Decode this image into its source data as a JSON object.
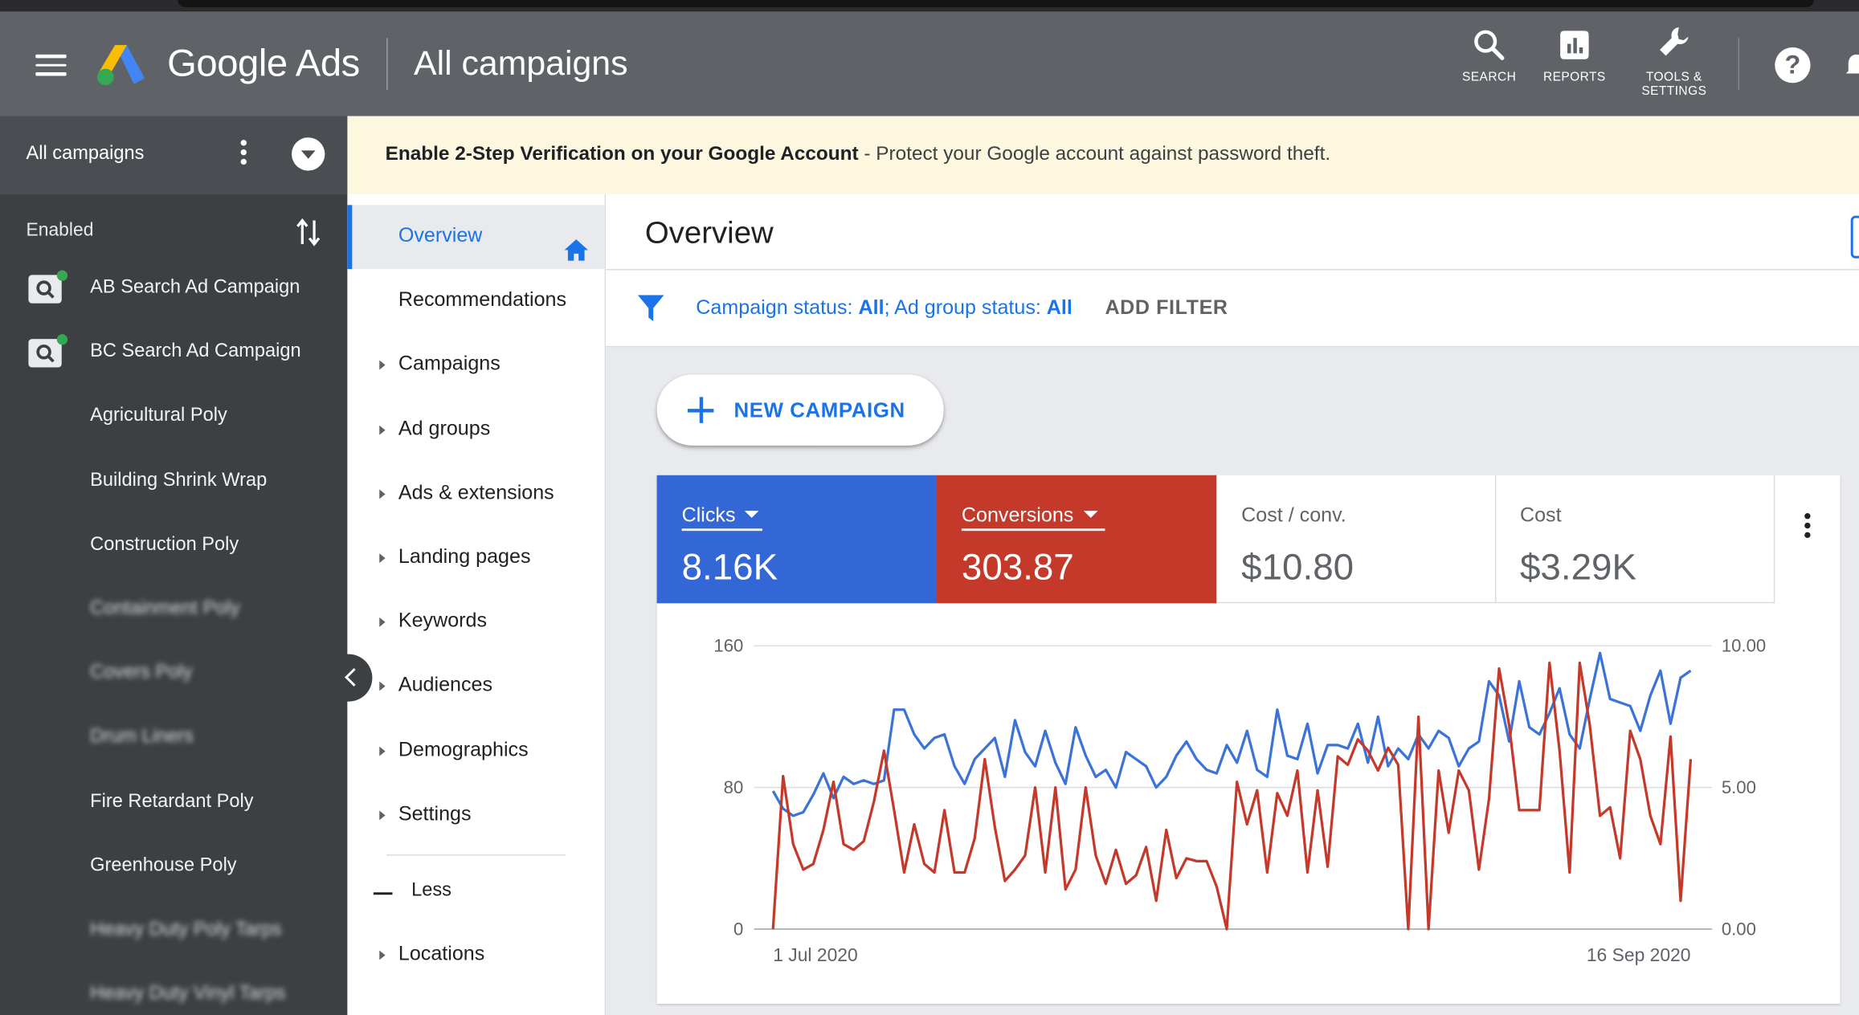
{
  "app": {
    "brand": "Google Ads",
    "page_title": "All campaigns"
  },
  "header": {
    "buttons": [
      {
        "label": "SEARCH",
        "icon": "search-icon"
      },
      {
        "label": "REPORTS",
        "icon": "reports-icon"
      },
      {
        "label_line1": "TOOLS &",
        "label_line2": "SETTINGS",
        "icon": "wrench-icon"
      }
    ],
    "help": "?"
  },
  "sidebar": {
    "title": "All campaigns",
    "section": "Enabled",
    "campaigns": [
      {
        "label": "AB Search Ad Campaign",
        "type": "search",
        "status_color": "#34a853"
      },
      {
        "label": "BC Search Ad Campaign",
        "type": "search",
        "status_color": "#34a853"
      },
      {
        "label": "Agricultural Poly"
      },
      {
        "label": "Building Shrink Wrap"
      },
      {
        "label": "Construction Poly"
      },
      {
        "label": "Containment Poly",
        "redacted": true
      },
      {
        "label": "Covers Poly",
        "redacted": true
      },
      {
        "label": "Drum Liners",
        "redacted": true
      },
      {
        "label": "Fire Retardant Poly"
      },
      {
        "label": "Greenhouse Poly"
      },
      {
        "label": "Heavy Duty Poly Tarps",
        "redacted": true
      },
      {
        "label": "Heavy Duty Vinyl Tarps",
        "redacted": true
      }
    ]
  },
  "banner": {
    "bold": "Enable 2-Step Verification on your Google Account",
    "rest": " - Protect your Google account against password theft."
  },
  "nav": {
    "items": [
      {
        "label": "Overview",
        "active": true,
        "icon": "home-icon"
      },
      {
        "label": "Recommendations"
      },
      {
        "label": "Campaigns",
        "expandable": true
      },
      {
        "label": "Ad groups",
        "expandable": true
      },
      {
        "label": "Ads & extensions",
        "expandable": true
      },
      {
        "label": "Landing pages",
        "expandable": true
      },
      {
        "label": "Keywords",
        "expandable": true
      },
      {
        "label": "Audiences",
        "expandable": true
      },
      {
        "label": "Demographics",
        "expandable": true
      },
      {
        "label": "Settings",
        "expandable": true
      }
    ],
    "less_label": "Less",
    "more_items": [
      {
        "label": "Locations",
        "expandable": true
      }
    ]
  },
  "overview": {
    "title": "Overview",
    "filter": {
      "parts": [
        {
          "text": "Campaign status: ",
          "bold": false
        },
        {
          "text": "All",
          "bold": true
        },
        {
          "text": "; Ad group status: ",
          "bold": false
        },
        {
          "text": "All",
          "bold": true
        }
      ],
      "add_filter": "ADD FILTER"
    },
    "new_campaign": "NEW CAMPAIGN",
    "scorecards": [
      {
        "name": "Clicks",
        "value": "8.16K",
        "color": "#3367d6",
        "selected": true
      },
      {
        "name": "Conversions",
        "value": "303.87",
        "color": "#c5392b",
        "selected": true
      },
      {
        "name": "Cost / conv.",
        "value": "$10.80"
      },
      {
        "name": "Cost",
        "value": "$3.29K"
      }
    ]
  },
  "chart_data": {
    "type": "line",
    "x_start_label": "1 Jul 2020",
    "x_end_label": "16 Sep 2020",
    "y_left": {
      "ticks": [
        "0",
        "80",
        "160"
      ],
      "range": [
        0,
        160
      ]
    },
    "y_right": {
      "ticks": [
        "0.00",
        "5.00",
        "10.00"
      ],
      "range": [
        0,
        10
      ]
    },
    "grid": true,
    "series": [
      {
        "name": "Clicks",
        "axis": "left",
        "color": "#3b73d9",
        "values": [
          78,
          68,
          64,
          66,
          76,
          88,
          74,
          86,
          82,
          84,
          82,
          84,
          124,
          124,
          110,
          102,
          108,
          110,
          92,
          82,
          96,
          102,
          108,
          86,
          118,
          100,
          92,
          112,
          94,
          82,
          114,
          98,
          86,
          90,
          80,
          100,
          96,
          92,
          80,
          86,
          98,
          106,
          96,
          90,
          88,
          104,
          94,
          112,
          90,
          86,
          124,
          98,
          96,
          116,
          88,
          104,
          104,
          102,
          116,
          94,
          120,
          92,
          102,
          96,
          110,
          102,
          112,
          108,
          92,
          102,
          106,
          140,
          132,
          106,
          140,
          114,
          110,
          122,
          136,
          110,
          102,
          130,
          156,
          130,
          128,
          126,
          112,
          132,
          146,
          116,
          142,
          146
        ]
      },
      {
        "name": "Conversions",
        "axis": "right",
        "color": "#c5392b",
        "values": [
          0,
          5.4,
          3.0,
          2.1,
          2.3,
          3.5,
          5.2,
          3.0,
          2.8,
          3.1,
          4.5,
          6.3,
          4.2,
          2.0,
          3.7,
          2.3,
          2.0,
          4.2,
          2.0,
          2.0,
          3.2,
          6.0,
          3.6,
          1.7,
          2.1,
          2.6,
          5.0,
          2.0,
          5.0,
          1.4,
          2.1,
          5.0,
          2.6,
          1.6,
          2.8,
          1.6,
          1.9,
          2.9,
          1.0,
          3.5,
          1.8,
          2.5,
          2.4,
          2.4,
          1.5,
          0.0,
          5.2,
          3.7,
          4.9,
          2.0,
          4.8,
          4.0,
          5.6,
          2.0,
          4.9,
          2.2,
          6.1,
          5.8,
          6.7,
          6.3,
          5.6,
          6.4,
          5.8,
          0.0,
          7.5,
          0.0,
          5.6,
          3.4,
          5.6,
          4.9,
          2.1,
          4.6,
          9.2,
          7.2,
          4.2,
          4.2,
          4.2,
          9.4,
          6.3,
          2.0,
          9.4,
          7.2,
          4.0,
          4.3,
          2.5,
          7.0,
          6.0,
          4.0,
          3.0,
          6.8,
          1.0,
          6.0
        ]
      }
    ]
  }
}
